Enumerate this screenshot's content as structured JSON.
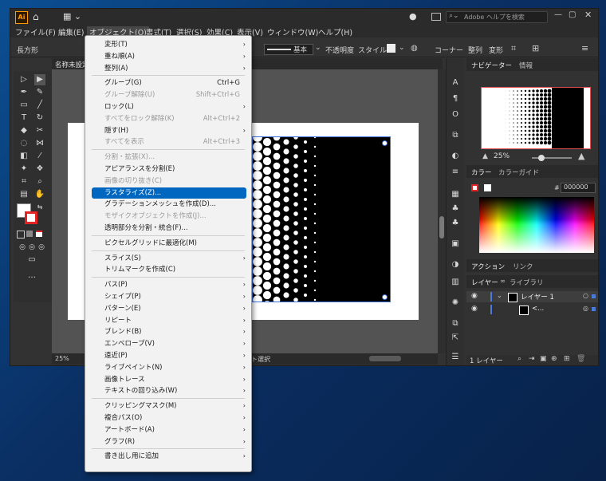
{
  "titlebar": {
    "app_icon": "Ai",
    "workspace_icon": "layout-icon",
    "search_placeholder": "Adobe ヘルプを検索"
  },
  "menubar": {
    "items": [
      "ファイル(F)",
      "編集(E)",
      "オブジェクト(O)",
      "書式(T)",
      "選択(S)",
      "効果(C)",
      "表示(V)",
      "ウィンドウ(W)",
      "ヘルプ(H)"
    ]
  },
  "controlbar": {
    "shape_label": "長方形",
    "stroke_style": "基本",
    "opacity_label": "不透明度",
    "style_label": "スタイル：",
    "corner_label": "コーナー",
    "align_label": "整列",
    "transform_label": "変形"
  },
  "document": {
    "tab_label": "名称未設定",
    "zoom": "25%",
    "status_text": "ト選択"
  },
  "object_menu": {
    "items": [
      {
        "label": "変形(T)",
        "submenu": true
      },
      {
        "label": "重ね順(A)",
        "submenu": true
      },
      {
        "label": "整列(A)",
        "submenu": true
      },
      {
        "label": "グループ(G)",
        "shortcut": "Ctrl+G"
      },
      {
        "label": "グループ解除(U)",
        "shortcut": "Shift+Ctrl+G",
        "disabled": true
      },
      {
        "label": "ロック(L)",
        "submenu": true
      },
      {
        "label": "すべてをロック解除(K)",
        "shortcut": "Alt+Ctrl+2",
        "disabled": true
      },
      {
        "label": "隠す(H)",
        "submenu": true
      },
      {
        "label": "すべてを表示",
        "shortcut": "Alt+Ctrl+3",
        "disabled": true
      },
      {
        "label": "分割・拡張(X)...",
        "disabled": true
      },
      {
        "label": "アピアランスを分割(E)"
      },
      {
        "label": "画像の切り抜き(C)",
        "disabled": true
      },
      {
        "label": "ラスタライズ(Z)...",
        "highlighted": true
      },
      {
        "label": "グラデーションメッシュを作成(D)..."
      },
      {
        "label": "モザイクオブジェクトを作成(J)...",
        "disabled": true
      },
      {
        "label": "透明部分を分割・統合(F)..."
      },
      {
        "label": "ピクセルグリッドに最適化(M)"
      },
      {
        "label": "スライス(S)",
        "submenu": true
      },
      {
        "label": "トリムマークを作成(C)"
      },
      {
        "label": "パス(P)",
        "submenu": true
      },
      {
        "label": "シェイプ(P)",
        "submenu": true
      },
      {
        "label": "パターン(E)",
        "submenu": true
      },
      {
        "label": "リピート",
        "submenu": true
      },
      {
        "label": "ブレンド(B)",
        "submenu": true
      },
      {
        "label": "エンベロープ(V)",
        "submenu": true
      },
      {
        "label": "遠近(P)",
        "submenu": true
      },
      {
        "label": "ライブペイント(N)",
        "submenu": true
      },
      {
        "label": "画像トレース",
        "submenu": true
      },
      {
        "label": "テキストの回り込み(W)",
        "submenu": true
      },
      {
        "label": "クリッピングマスク(M)",
        "submenu": true
      },
      {
        "label": "複合パス(O)",
        "submenu": true
      },
      {
        "label": "アートボード(A)",
        "submenu": true
      },
      {
        "label": "グラフ(R)",
        "submenu": true
      },
      {
        "label": "書き出し用に追加",
        "submenu": true
      }
    ]
  },
  "navigator": {
    "tab_label": "ナビゲーター",
    "info_label": "情報",
    "zoom": "25%"
  },
  "color_panel": {
    "tab_label": "カラー",
    "guide_label": "カラーガイド",
    "hex_value": "000000"
  },
  "actions_panel": {
    "tab_label": "アクション",
    "links_label": "リンク"
  },
  "layers_panel": {
    "tab_label": "レイヤー",
    "library_label": "ライブラリ",
    "layer_name": "レイヤー 1",
    "sublayer_name": "<...",
    "footer_count": "1 レイヤー"
  },
  "colors": {
    "accent": "#0067c0",
    "selection": "#3b6fd9",
    "layer": "#4a7bd8"
  }
}
